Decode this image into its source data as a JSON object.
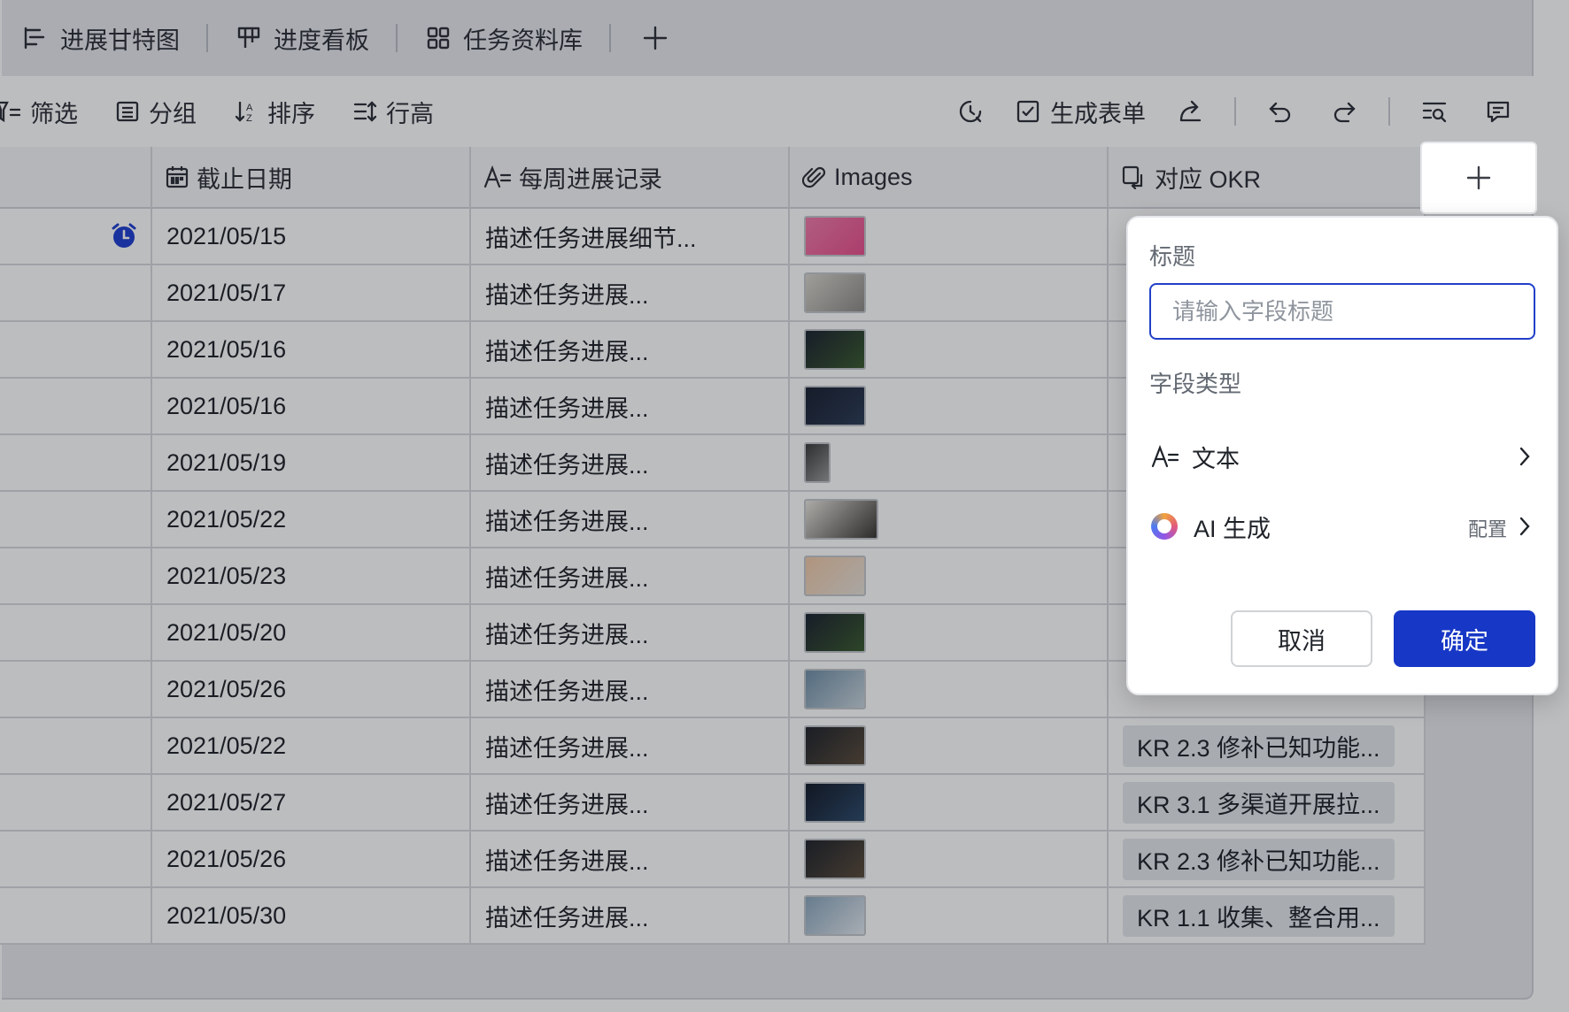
{
  "tabs": [
    {
      "label": "进展甘特图",
      "icon": "gantt-icon"
    },
    {
      "label": "进度看板",
      "icon": "kanban-icon"
    },
    {
      "label": "任务资料库",
      "icon": "grid-icon"
    }
  ],
  "toolbar": {
    "filter": "筛选",
    "group": "分组",
    "sort": "排序",
    "row_height": "行高",
    "generate_form": "生成表单"
  },
  "columns": {
    "deadline": "截止日期",
    "weekly_progress": "每周进展记录",
    "images": "Images",
    "okr": "对应 OKR"
  },
  "rows": [
    {
      "date": "2021/05/15",
      "progress": "描述任务进展细节...",
      "alarm": true,
      "okr": ""
    },
    {
      "date": "2021/05/17",
      "progress": "描述任务进展...",
      "okr": ""
    },
    {
      "date": "2021/05/16",
      "progress": "描述任务进展...",
      "okr": ""
    },
    {
      "date": "2021/05/16",
      "progress": "描述任务进展...",
      "okr": ""
    },
    {
      "date": "2021/05/19",
      "progress": "描述任务进展...",
      "okr": ""
    },
    {
      "date": "2021/05/22",
      "progress": "描述任务进展...",
      "okr": ""
    },
    {
      "date": "2021/05/23",
      "progress": "描述任务进展...",
      "okr": ""
    },
    {
      "date": "2021/05/20",
      "progress": "描述任务进展...",
      "okr": ""
    },
    {
      "date": "2021/05/26",
      "progress": "描述任务进展...",
      "okr": ""
    },
    {
      "date": "2021/05/22",
      "progress": "描述任务进展...",
      "okr": "KR 2.3 修补已知功能..."
    },
    {
      "date": "2021/05/27",
      "progress": "描述任务进展...",
      "okr": "KR 3.1 多渠道开展拉..."
    },
    {
      "date": "2021/05/26",
      "progress": "描述任务进展...",
      "okr": "KR 2.3 修补已知功能..."
    },
    {
      "date": "2021/05/30",
      "progress": "描述任务进展...",
      "okr": "KR 1.1 收集、整合用..."
    }
  ],
  "popup": {
    "title_label": "标题",
    "title_placeholder": "请输入字段标题",
    "title_value": "",
    "type_label": "字段类型",
    "type_selected": "文本",
    "ai_option": "AI 生成",
    "ai_config": "配置",
    "cancel": "取消",
    "confirm": "确定"
  },
  "colors": {
    "accent": "#1737c6",
    "alarm": "#1e3fd0"
  }
}
